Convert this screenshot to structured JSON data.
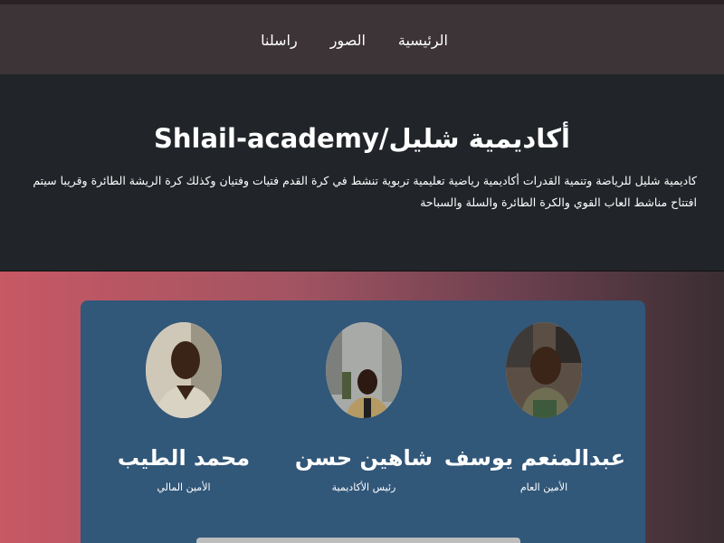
{
  "nav": {
    "items": [
      {
        "label": "الرئيسية"
      },
      {
        "label": "الصور"
      },
      {
        "label": "راسلنا"
      }
    ]
  },
  "hero": {
    "title": "أكاديمية شليل/Shlail-academy",
    "description": "كاديمية شليل للرياضة وتنمية القدرات أكاديمية رياضية تعليمية تربوية تنشط في كرة القدم فتيات وفتيان وكذلك كرة الريشة الطائرة وقريبا سيتم افتتاح مناشط العاب القوي والكرة الطائرة والسلة والسباحة"
  },
  "team": {
    "members": [
      {
        "name": "عبدالمنعم يوسف",
        "role": "الأمين العام",
        "avatar_icon": "person-photo-icon"
      },
      {
        "name": "شاهين حسن",
        "role": "رئيس الأكاديمية",
        "avatar_icon": "person-photo-icon"
      },
      {
        "name": "محمد الطيب",
        "role": "الأمين المالي",
        "avatar_icon": "person-photo-icon"
      }
    ]
  },
  "colors": {
    "nav_bg": "#3d3437",
    "hero_bg": "#212529",
    "card_bg": "#315779",
    "gradient_left": "#c75864",
    "gradient_right": "#3a2e33"
  }
}
